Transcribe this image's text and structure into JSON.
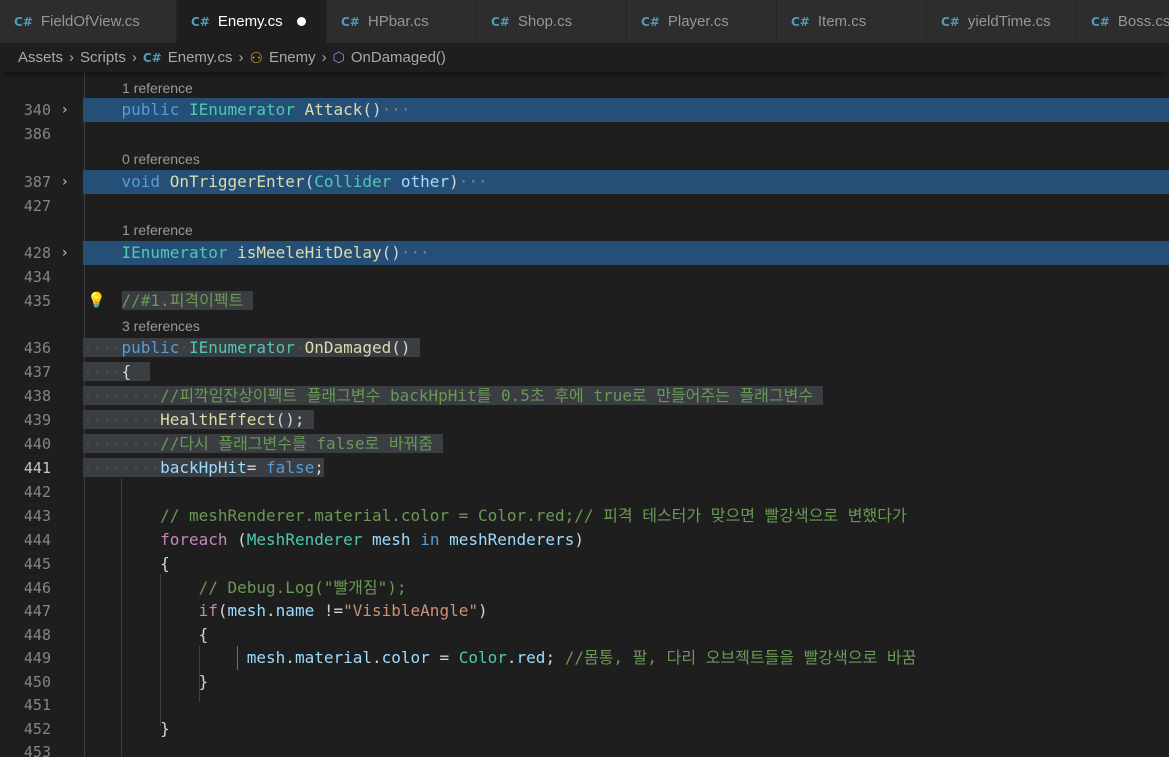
{
  "tabs": [
    {
      "label": "FieldOfView.cs",
      "active": false
    },
    {
      "label": "Enemy.cs",
      "active": true,
      "modified": true
    },
    {
      "label": "HPbar.cs",
      "active": false
    },
    {
      "label": "Shop.cs",
      "active": false
    },
    {
      "label": "Player.cs",
      "active": false
    },
    {
      "label": "Item.cs",
      "active": false
    },
    {
      "label": "yieldTime.cs",
      "active": false
    },
    {
      "label": "Boss.cs",
      "active": false
    }
  ],
  "breadcrumb": {
    "assets": "Assets",
    "scripts": "Scripts",
    "file": "Enemy.cs",
    "cls": "Enemy",
    "method": "OnDamaged()"
  },
  "codelens": {
    "l340": "1 reference",
    "l387": "0 references",
    "l428": "1 reference",
    "l436": "3 references"
  },
  "line_numbers": [
    "340",
    "386",
    "387",
    "427",
    "428",
    "434",
    "435",
    "436",
    "437",
    "438",
    "439",
    "440",
    "441",
    "442",
    "443",
    "444",
    "445",
    "446",
    "447",
    "448",
    "449",
    "450",
    "451",
    "452",
    "453"
  ],
  "code": {
    "l340": {
      "kw": "public",
      "ty": "IEnumerator",
      "fn": "Attack",
      "rest": "()",
      "fold": "···"
    },
    "l387": {
      "kw": "void",
      "fn": "OnTriggerEnter",
      "p1": "(",
      "ty": "Collider",
      "va": "other",
      "p2": ")",
      "fold": "···"
    },
    "l428": {
      "ty": "IEnumerator",
      "fn": "isMeeleHitDelay",
      "rest": "()",
      "fold": "···"
    },
    "l435": {
      "cm": "//#1.피격이펙트"
    },
    "l436": {
      "kw": "public",
      "ty": "IEnumerator",
      "fn": "OnDamaged",
      "rest": "()"
    },
    "l437": {
      "brace": "{"
    },
    "l438": {
      "cm": "//피깍임잔상이펙트 플래그변수 backHpHit를 0.5초 후에 true로 만들어주는 플래그변수"
    },
    "l439": {
      "fn": "HealthEffect",
      "rest": "();"
    },
    "l440": {
      "cm": "//다시 플래그변수를 false로 바꿔줌"
    },
    "l441": {
      "va": "backHpHit",
      "op": "=",
      "kw": "false",
      "rest": ";"
    },
    "l443": {
      "cm": "// meshRenderer.material.color = Color.red;// 피격 테스터가 맞으면 빨강색으로 변했다가"
    },
    "l444": {
      "ctl": "foreach",
      "p1": "(",
      "ty": "MeshRenderer",
      "va": "mesh",
      "kw": "in",
      "va2": "meshRenderers",
      "p2": ")"
    },
    "l445": {
      "brace": "{"
    },
    "l446": {
      "cm": "// Debug.Log(\"빨개짐\");"
    },
    "l447": {
      "ctl": "if",
      "p1": "(",
      "va": "mesh",
      "dot": ".",
      "va2": "name",
      "op": " !=",
      "st": "\"VisibleAngle\"",
      "p2": ")"
    },
    "l448": {
      "brace": "{"
    },
    "l449": {
      "va": "mesh",
      "d1": ".",
      "va2": "material",
      "d2": ".",
      "va3": "color",
      "op": " = ",
      "ty": "Color",
      "d3": ".",
      "va4": "red",
      "semi": ";",
      "cm": " //몸통, 팔, 다리 오브젝트들을 빨강색으로 바꿈"
    },
    "l450": {
      "brace": "}"
    },
    "l452": {
      "brace": "}"
    }
  },
  "colors": {
    "background": "#1e1e1e",
    "keyword": "#569cd6",
    "type": "#4ec9b0",
    "function": "#dcdcaa",
    "variable": "#9cdcfe",
    "comment": "#6a9955",
    "string": "#ce9178",
    "control": "#c586c0"
  }
}
